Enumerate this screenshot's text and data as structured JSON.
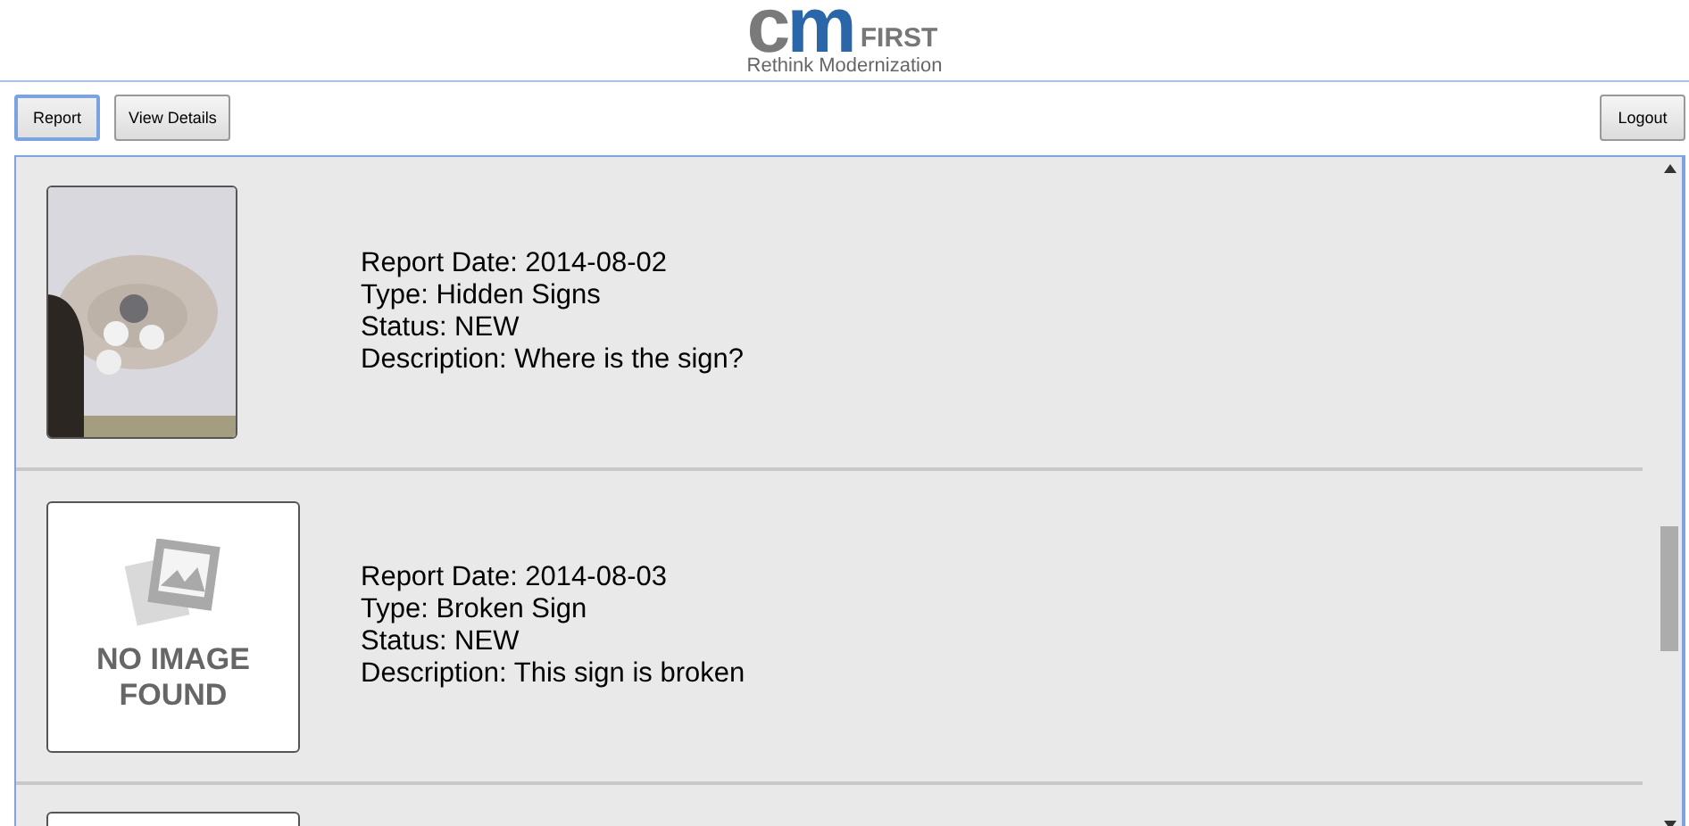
{
  "logo": {
    "mark_left": "c",
    "mark_right": "m",
    "word": "FIRST",
    "tagline": "Rethink Modernization"
  },
  "toolbar": {
    "buttons": [
      {
        "label": "Report",
        "selected": true
      },
      {
        "label": "View Details",
        "selected": false
      }
    ],
    "logout": "Logout"
  },
  "reports": [
    {
      "lines": [
        "Report Date: 2014-08-02",
        "Type: Hidden Signs",
        "Status: NEW",
        "Description: Where is the sign?"
      ]
    },
    {
      "kind": "placeholder",
      "placeholder_text": [
        "NO IMAGE",
        "FOUND"
      ],
      "lines": [
        "Report Date: 2014-08-03",
        "Type: Broken Sign",
        "Status: NEW",
        "Description: This sign is broken"
      ]
    },
    {
      "kind": "placeholder"
    }
  ]
}
